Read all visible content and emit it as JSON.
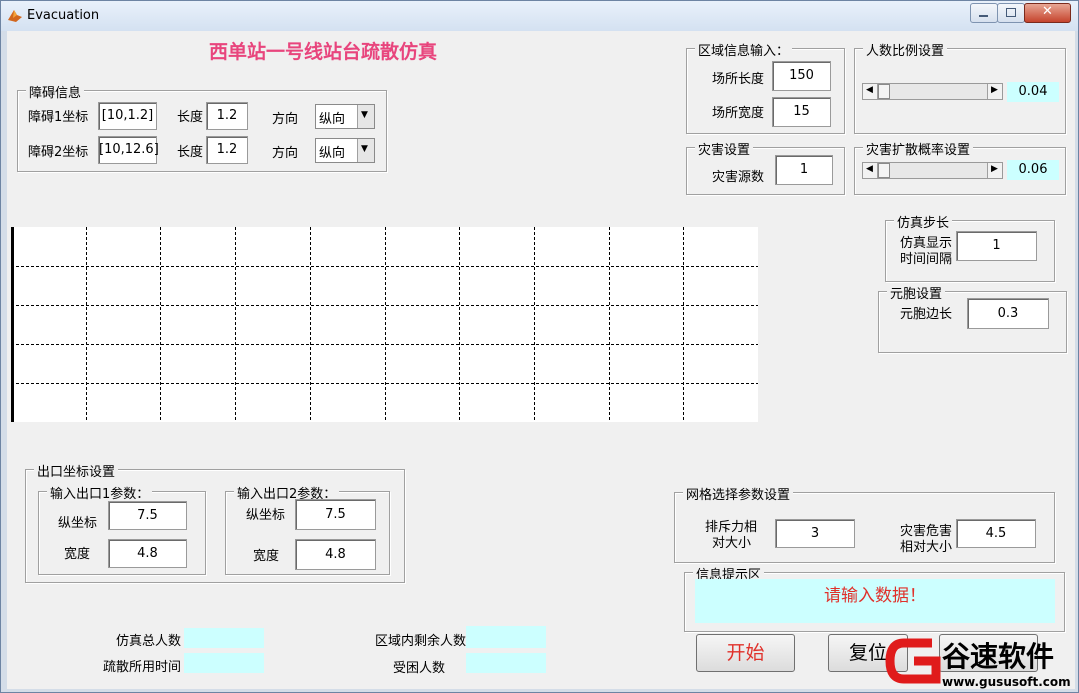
{
  "window": {
    "title": "Evacuation"
  },
  "header": {
    "title": "西单站一号线站台疏散仿真"
  },
  "obstacle": {
    "group_title": "障碍信息",
    "rows": [
      {
        "coord_label": "障碍1坐标",
        "coord_value": "[10,1.2]",
        "length_label": "长度",
        "length_value": "1.2",
        "dir_label": "方向",
        "dir_value": "纵向"
      },
      {
        "coord_label": "障碍2坐标",
        "coord_value": "[10,12.6]",
        "length_label": "长度",
        "length_value": "1.2",
        "dir_label": "方向",
        "dir_value": "纵向"
      }
    ]
  },
  "area": {
    "group_title": "区域信息输入：",
    "length_label": "场所长度",
    "length_value": "150",
    "width_label": "场所宽度",
    "width_value": "15"
  },
  "people_ratio": {
    "group_title": "人数比例设置",
    "value": "0.04",
    "level": 0.04
  },
  "disaster": {
    "group_title": "灾害设置",
    "source_label": "灾害源数",
    "source_value": "1"
  },
  "spread": {
    "group_title": "灾害扩散概率设置",
    "value": "0.06",
    "level": 0.06
  },
  "sim_step": {
    "group_title": "仿真步长",
    "label_line1": "仿真显示",
    "label_line2": "时间间隔",
    "value": "1"
  },
  "cell": {
    "group_title": "元胞设置",
    "label": "元胞边长",
    "value": "0.3"
  },
  "exit": {
    "group_title": "出口坐标设置",
    "exit1": {
      "title": "输入出口1参数：",
      "y_label": "纵坐标",
      "y_value": "7.5",
      "w_label": "宽度",
      "w_value": "4.8"
    },
    "exit2": {
      "title": "输入出口2参数：",
      "y_label": "纵坐标",
      "y_value": "7.5",
      "w_label": "宽度",
      "w_value": "4.8"
    }
  },
  "grid_params": {
    "group_title": "网格选择参数设置",
    "repulse_line1": "排斥力相",
    "repulse_line2": "对大小",
    "repulse_value": "3",
    "hazard_line1": "灾害危害",
    "hazard_line2": "相对大小",
    "hazard_value": "4.5"
  },
  "info": {
    "group_title": "信息提示区",
    "message": "请输入数据！"
  },
  "stats": {
    "total_label": "仿真总人数",
    "time_label": "疏散所用时间",
    "remain_label": "区域内剩余人数",
    "trapped_label": "受困人数"
  },
  "buttons": {
    "start": "开始",
    "reset": "复位"
  },
  "watermark": {
    "brand": "谷速软件",
    "url": "www.gususoft.com"
  },
  "colors": {
    "title_pink": "#e8457d",
    "message_red": "#e0302a",
    "cyan_field": "#ccffff"
  }
}
